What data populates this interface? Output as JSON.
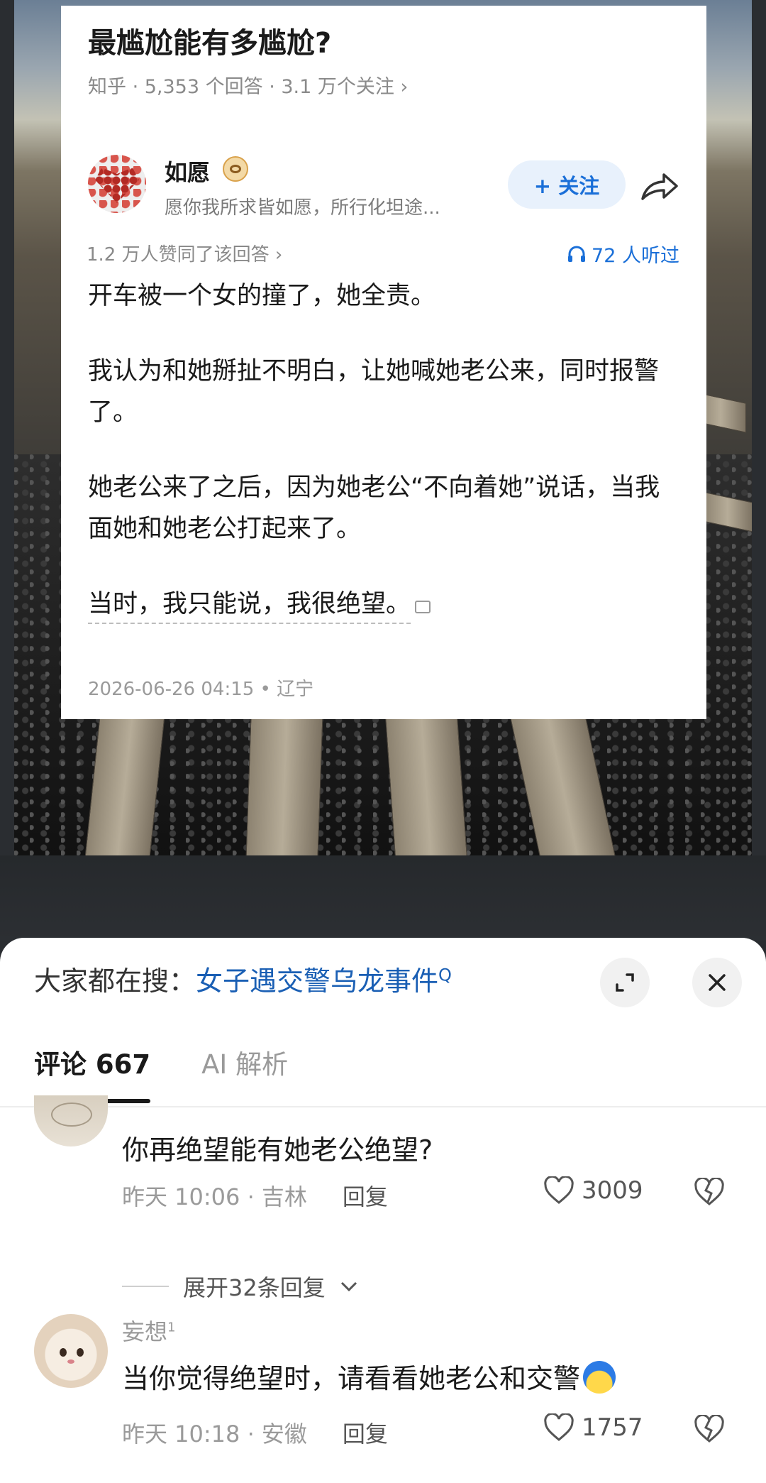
{
  "question": {
    "title": "最尴尬能有多尴尬?",
    "meta": "知乎 · 5,353 个回答 · 3.1 万个关注 ›"
  },
  "author": {
    "name": "如愿",
    "bio": "愿你我所求皆如愿，所行化坦途...",
    "follow_label": "+ 关注"
  },
  "answer": {
    "likes": "1.2 万人赞同了该回答 ›",
    "listen": "72 人听过",
    "paragraphs": [
      "开车被一个女的撞了，她全责。",
      "我认为和她掰扯不明白，让她喊她老公来，同时报警了。",
      "她老公来了之后，因为她老公“不向着她”说话，当我面她和她老公打起来了。"
    ],
    "last_line": "当时，我只能说，我很绝望。",
    "timestamp": "2026-06-26 04:15 • 辽宁"
  },
  "sheet": {
    "search_prefix": "大家都在搜：",
    "search_keyword": "女子遇交警乌龙事件",
    "search_mark": "Q",
    "tabs": [
      {
        "label": "评论 667",
        "active": true
      },
      {
        "label": "AI 解析",
        "active": false
      }
    ]
  },
  "comments": [
    {
      "name_partial": "",
      "text": "你再绝望能有她老公绝望?",
      "time": "昨天 10:06 · 吉林",
      "reply": "回复",
      "likes": "3009",
      "expand": "展开32条回复"
    },
    {
      "name": "妄想",
      "name_sup": "1",
      "text": "当你觉得绝望时，请看看她老公和交警",
      "time": "昨天 10:18 · 安徽",
      "reply": "回复",
      "likes": "1757"
    }
  ],
  "icons": [
    "badge-icon",
    "share-icon",
    "headphones-icon",
    "comment-icon",
    "expand-icon",
    "close-icon",
    "heart-icon",
    "broken-heart-icon",
    "chevron-down-icon"
  ],
  "colors": {
    "accent": "#1a6fd8",
    "keyword": "#1a5fb4"
  }
}
